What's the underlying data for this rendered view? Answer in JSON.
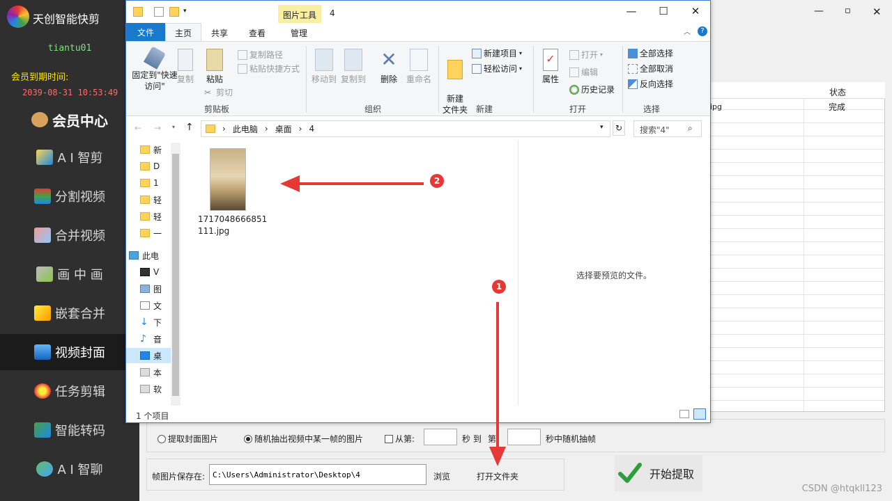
{
  "sidebar": {
    "app_title": "天创智能快剪",
    "user": "tiantu01",
    "expire_label": "会员到期时间:",
    "expire_value": "2039-08-31 10:53:49",
    "items": [
      {
        "label": "会员中心",
        "icon": "member-icon"
      },
      {
        "label": "A I 智剪",
        "icon": "ai-cut-icon"
      },
      {
        "label": "分割视频",
        "icon": "split-icon"
      },
      {
        "label": "合并视频",
        "icon": "merge-icon"
      },
      {
        "label": "画 中 画",
        "icon": "pip-icon"
      },
      {
        "label": "嵌套合并",
        "icon": "nest-icon"
      },
      {
        "label": "视频封面",
        "icon": "cover-icon",
        "active": true
      },
      {
        "label": "任务剪辑",
        "icon": "task-icon"
      },
      {
        "label": "智能转码",
        "icon": "transcode-icon"
      },
      {
        "label": "A I 智聊",
        "icon": "chat-icon"
      }
    ]
  },
  "bg_app": {
    "grid": {
      "col_status": "状态",
      "row1_name": "ipg",
      "row1_status": "完成"
    }
  },
  "explorer": {
    "context_tab": "图片工具",
    "title": "4",
    "tabs": {
      "file": "文件",
      "home": "主页",
      "share": "共享",
      "view": "查看",
      "manage": "管理"
    },
    "ribbon": {
      "clipboard": {
        "label": "剪贴板",
        "pin": "固定到\"快速访问\"",
        "copy": "复制",
        "paste": "粘贴",
        "copy_path": "复制路径",
        "paste_shortcut": "粘贴快捷方式",
        "cut": "剪切"
      },
      "organize": {
        "label": "组织",
        "move_to": "移动到",
        "copy_to": "复制到",
        "delete": "删除",
        "rename": "重命名"
      },
      "new": {
        "label": "新建",
        "new_folder": "新建\n文件夹",
        "new_item": "新建项目",
        "easy_access": "轻松访问"
      },
      "open": {
        "label": "打开",
        "properties": "属性",
        "open": "打开",
        "edit": "编辑",
        "history": "历史记录"
      },
      "select": {
        "label": "选择",
        "select_all": "全部选择",
        "select_none": "全部取消",
        "invert": "反向选择"
      }
    },
    "address": [
      "此电脑",
      "桌面",
      "4"
    ],
    "search_placeholder": "搜索\"4\"",
    "nav_items": [
      "新",
      "D",
      "1",
      "轻",
      "轻",
      "一",
      "此电",
      "V",
      "图",
      "文",
      "下",
      "音",
      "桌",
      "本",
      "软"
    ],
    "file_name_line1": "1717048666851",
    "file_name_line2": "111.jpg",
    "preview_text": "选择要预览的文件。",
    "status": "1 个项目"
  },
  "bottom": {
    "radio1": "提取封面图片",
    "radio2": "随机抽出视频中某一帧的图片",
    "from_label": "从第:",
    "sec_to": "秒 到",
    "di": "第",
    "random_frame": "秒中随机抽帧",
    "save_label": "帧图片保存在:",
    "save_path": "C:\\Users\\Administrator\\Desktop\\4",
    "browse": "浏览",
    "open_folder": "打开文件夹",
    "start": "开始提取"
  },
  "annotations": {
    "badge1": "1",
    "badge2": "2"
  },
  "watermark": "CSDN @htqkll123",
  "colors": {
    "sidebar_bg": "#2f2f2f",
    "accent_blue": "#1979ca",
    "arrow_red": "#e53935",
    "expire_yellow": "#ffe600"
  }
}
